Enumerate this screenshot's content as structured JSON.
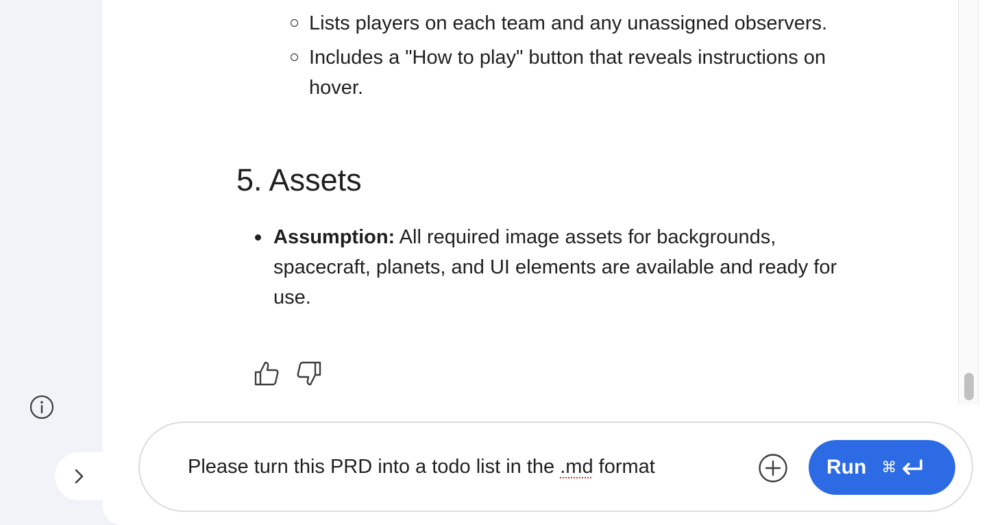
{
  "content": {
    "sub_items": [
      "Lists players on each team and any unassigned observers.",
      "Includes a \"How to play\" button that reveals instructions on hover."
    ],
    "section_heading": "5. Assets",
    "assets_item": {
      "label": "Assumption:",
      "text": " All required image assets for backgrounds, spacecraft, planets, and UI elements are available and ready for use."
    }
  },
  "feedback": {
    "like_icon": "thumbs-up-icon",
    "dislike_icon": "thumbs-down-icon"
  },
  "sidebar": {
    "info_icon": "info-icon",
    "expand_icon": "chevron-right-icon"
  },
  "prompt": {
    "text_before": "Please turn this PRD into a todo list in the ",
    "misspelled": ".md",
    "text_after": " format",
    "add_icon": "plus-circle-icon",
    "run_label": "Run",
    "shortcut_cmd": "⌘",
    "shortcut_enter_icon": "enter-icon",
    "accent_color": "#2d6be4"
  }
}
